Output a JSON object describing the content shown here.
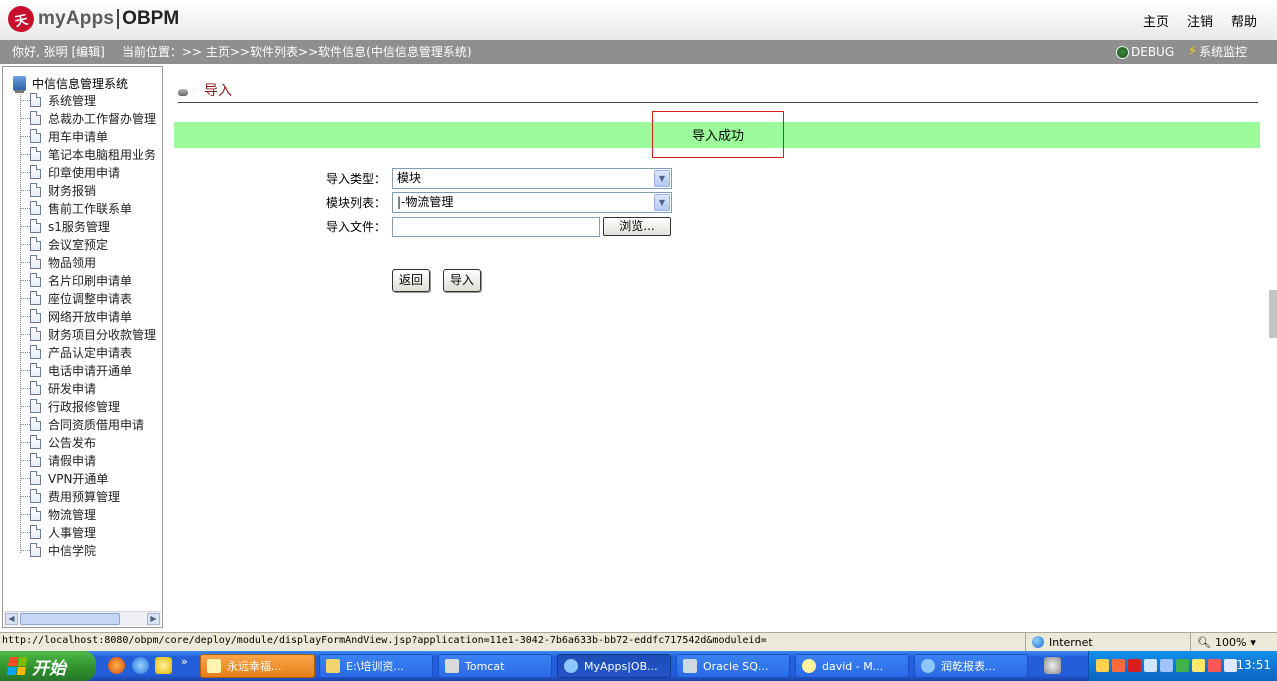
{
  "header": {
    "logo_text": "myApps",
    "logo_product": "OBPM",
    "links": [
      "主页",
      "注销",
      "帮助"
    ]
  },
  "infobar": {
    "greeting": "你好, 张明 [编辑]",
    "breadcrumb": "当前位置：>> 主页>>软件列表>>软件信息(中信信息管理系统)",
    "debug_label": "DEBUG",
    "monitor_label": "系统监控"
  },
  "sidebar": {
    "root": "中信信息管理系统",
    "items": [
      "系统管理",
      "总裁办工作督办管理",
      "用车申请单",
      "笔记本电脑租用业务",
      "印章使用申请",
      "财务报销",
      "售前工作联系单",
      "s1服务管理",
      "会议室预定",
      "物品领用",
      "名片印刷申请单",
      "座位调整申请表",
      "网络开放申请单",
      "财务项目分收款管理",
      "产品认定申请表",
      "电话申请开通单",
      "研发申请",
      "行政报修管理",
      "合同资质借用申请",
      "公告发布",
      "请假申请",
      "VPN开通单",
      "费用预算管理",
      "物流管理",
      "人事管理",
      "中信学院"
    ]
  },
  "main": {
    "section_title": "导入",
    "success_message": "导入成功",
    "import_type_label": "导入类型：",
    "import_type_value": "模块",
    "module_list_label": "模块列表：",
    "module_list_value": "|-物流管理",
    "import_file_label": "导入文件：",
    "file_value": "",
    "browse_label": "浏览...",
    "back_label": "返回",
    "import_label": "导入"
  },
  "statusbar": {
    "url": "http://localhost:8080/obpm/core/deploy/module/displayFormAndView.jsp?application=11e1-3042-7b6a633b-bb72-eddfc717542d&moduleid=",
    "zone": "Internet",
    "zoom": "100%"
  },
  "taskbar": {
    "start": "开始",
    "tasks": [
      "永远幸福...",
      "E:\\培训资...",
      "Tomcat",
      "MyApps|OB...",
      "Oracle SQ...",
      "david - M...",
      "润乾报表..."
    ],
    "time": "13:51"
  },
  "colors": {
    "success_bg": "#9cfc9c",
    "highlight_border": "#d21e1e",
    "section_title": "#8b1a1a",
    "infobar_bg": "#8f8f8f",
    "taskbar_blue": "#245edb"
  }
}
